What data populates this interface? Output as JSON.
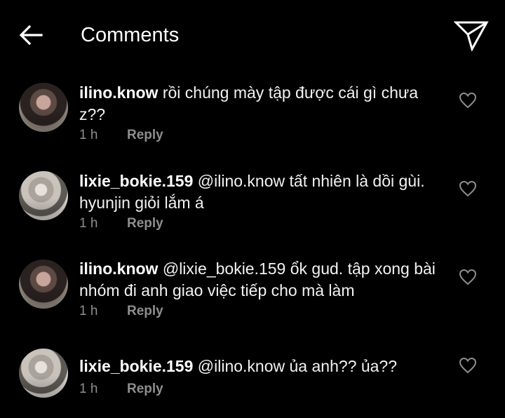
{
  "header": {
    "title": "Comments",
    "back_icon": "arrow-left-icon",
    "share_icon": "paper-plane-icon"
  },
  "colors": {
    "background": "#000000",
    "text": "#ffffff",
    "muted": "#8e8e8e"
  },
  "comments": [
    {
      "username": "ilino.know",
      "text": "rồi chúng mày tập được cái gì chưa z??",
      "time": "1 h",
      "reply_label": "Reply"
    },
    {
      "username": "lixie_bokie.159",
      "text": "@ilino.know tất nhiên là dồi gùi. hyunjin giỏi lắm á",
      "time": "1 h",
      "reply_label": "Reply"
    },
    {
      "username": "ilino.know",
      "text": "@lixie_bokie.159 ổk gud. tập xong bài nhóm đi anh giao việc tiếp cho mà làm",
      "time": "1 h",
      "reply_label": "Reply"
    },
    {
      "username": "lixie_bokie.159",
      "text": "@ilino.know ủa anh?? ủa??",
      "time": "1 h",
      "reply_label": "Reply"
    }
  ]
}
